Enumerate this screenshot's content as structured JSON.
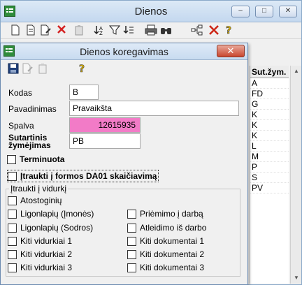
{
  "bg_window": {
    "title": "Dienos",
    "controls": [
      "–",
      "□",
      "✕"
    ]
  },
  "bg_toolbar": {
    "icons": [
      "new-icon",
      "copy-doc-icon",
      "edit-icon",
      "delete-icon",
      "paste-icon",
      "sort-icon",
      "filter-icon",
      "list-icon",
      "print-icon",
      "find-icon",
      "tree-icon",
      "tools-icon",
      "help-icon"
    ]
  },
  "bg_grid": {
    "header": "Sut.žym.",
    "cells": [
      "A",
      "FD",
      "G",
      "K",
      "K",
      "K",
      "L",
      "M",
      "P",
      "S",
      "PV",
      "",
      "",
      "",
      "",
      "",
      "",
      ""
    ]
  },
  "dialog": {
    "title": "Dienos koregavimas",
    "close_label": "✕",
    "toolbar_icons": [
      "save-icon",
      "edit-disabled-icon",
      "copy-disabled-icon",
      "help-icon"
    ],
    "fields": {
      "kodas_label": "Kodas",
      "kodas_value": "B",
      "pavadinimas_label": "Pavadinimas",
      "pavadinimas_value": "Pravaikšta",
      "spalva_label": "Spalva",
      "spalva_value": "12615935",
      "spalva_color": "#f27bc7",
      "sutartinis_label_1": "Sutartinis",
      "sutartinis_label_2": "žymėjimas",
      "sutartinis_value": "PB"
    },
    "checks": {
      "terminuota": "Terminuota",
      "itraukti_da01": "Įtraukti į formos DA01 skaičiavimą"
    },
    "group": {
      "title": "Įtraukti į vidurkį",
      "left": [
        "Atostoginių",
        "Ligonlapių (Įmonės)",
        "Ligonlapių (Sodros)",
        "Kiti vidurkiai 1",
        "Kiti vidurkiai 2",
        "Kiti vidurkiai 3"
      ],
      "right": [
        "Priėmimo į darbą",
        "Atleidimo iš darbo",
        "Kiti dokumentai 1",
        "Kiti dokumentai 2",
        "Kiti dokumentai 3"
      ]
    }
  }
}
